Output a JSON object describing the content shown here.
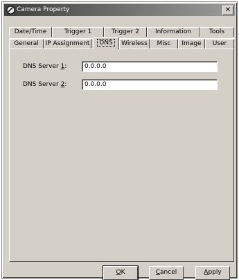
{
  "window": {
    "title": "Camera Property",
    "close_glyph": "✕"
  },
  "tabs_row1": [
    {
      "label": "Date/Time"
    },
    {
      "label": "Trigger 1"
    },
    {
      "label": "Trigger 2"
    },
    {
      "label": "Information"
    },
    {
      "label": "Tools"
    }
  ],
  "tabs_row2": [
    {
      "label": "General"
    },
    {
      "label": "IP Assignment"
    },
    {
      "label": "DNS",
      "active": true
    },
    {
      "label": "Wireless"
    },
    {
      "label": "Misc"
    },
    {
      "label": "Image"
    },
    {
      "label": "User"
    }
  ],
  "dns": {
    "server1_label_prefix": "DNS Server ",
    "server1_label_key": "1",
    "server1_label_suffix": ":",
    "server1_value": "0.0.0.0",
    "server2_label_prefix": "DNS Server ",
    "server2_label_key": "2",
    "server2_label_suffix": ":",
    "server2_value": "0.0.0.0"
  },
  "buttons": {
    "ok_key": "O",
    "ok_rest": "K",
    "cancel_key": "C",
    "cancel_rest": "ancel",
    "apply_key": "A",
    "apply_rest": "pply"
  },
  "colors": {
    "dialog_face": "#d4d0c8",
    "titlebar_start": "#404040",
    "titlebar_end": "#9c9c9c"
  }
}
